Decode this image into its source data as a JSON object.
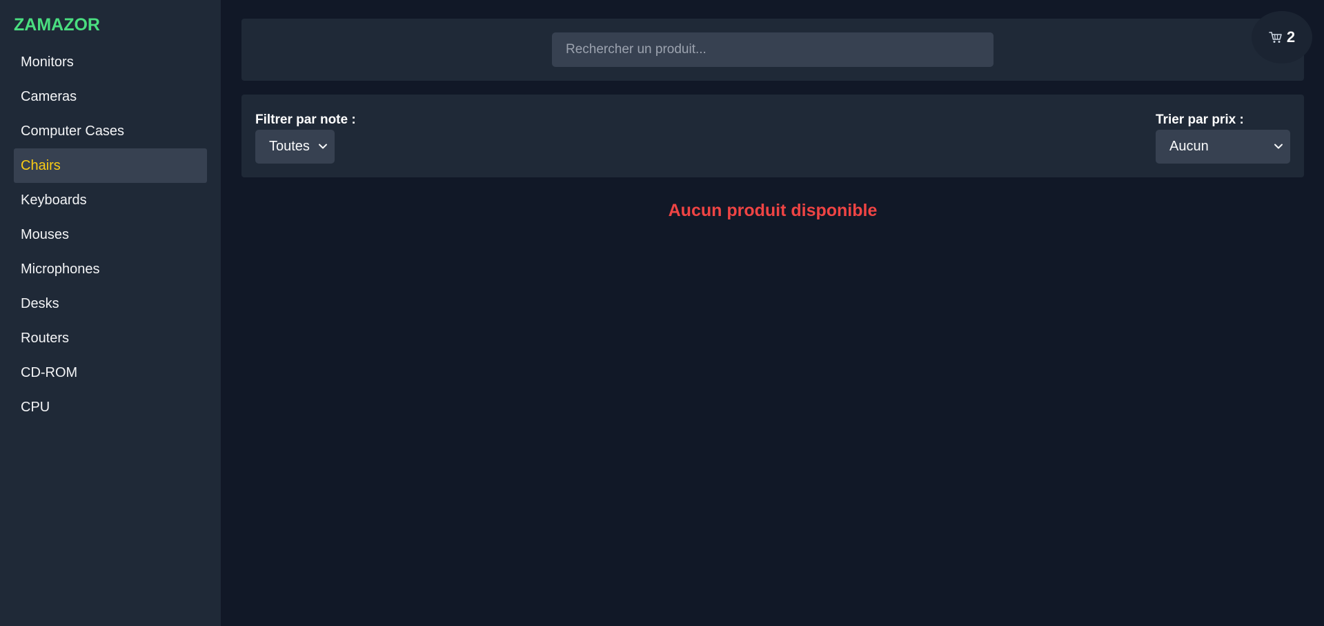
{
  "brand": "ZAMAZOR",
  "categories": [
    {
      "label": "Monitors"
    },
    {
      "label": "Cameras"
    },
    {
      "label": "Computer Cases"
    },
    {
      "label": "Chairs",
      "active": true
    },
    {
      "label": "Keyboards"
    },
    {
      "label": "Mouses"
    },
    {
      "label": "Microphones"
    },
    {
      "label": "Desks"
    },
    {
      "label": "Routers"
    },
    {
      "label": "CD-ROM"
    },
    {
      "label": "CPU"
    }
  ],
  "search": {
    "placeholder": "Rechercher un produit...",
    "value": ""
  },
  "filters": {
    "note_label": "Filtrer par note :",
    "note_selected": "Toutes",
    "sort_label": "Trier par prix :",
    "sort_selected": "Aucun"
  },
  "empty_message": "Aucun produit disponible",
  "cart": {
    "icon": "cart-icon",
    "count": "2"
  },
  "colors": {
    "brand": "#4ade80",
    "active_item": "#facc15",
    "empty_message": "#ef4444",
    "background": "#111827",
    "panel": "#1f2937"
  }
}
